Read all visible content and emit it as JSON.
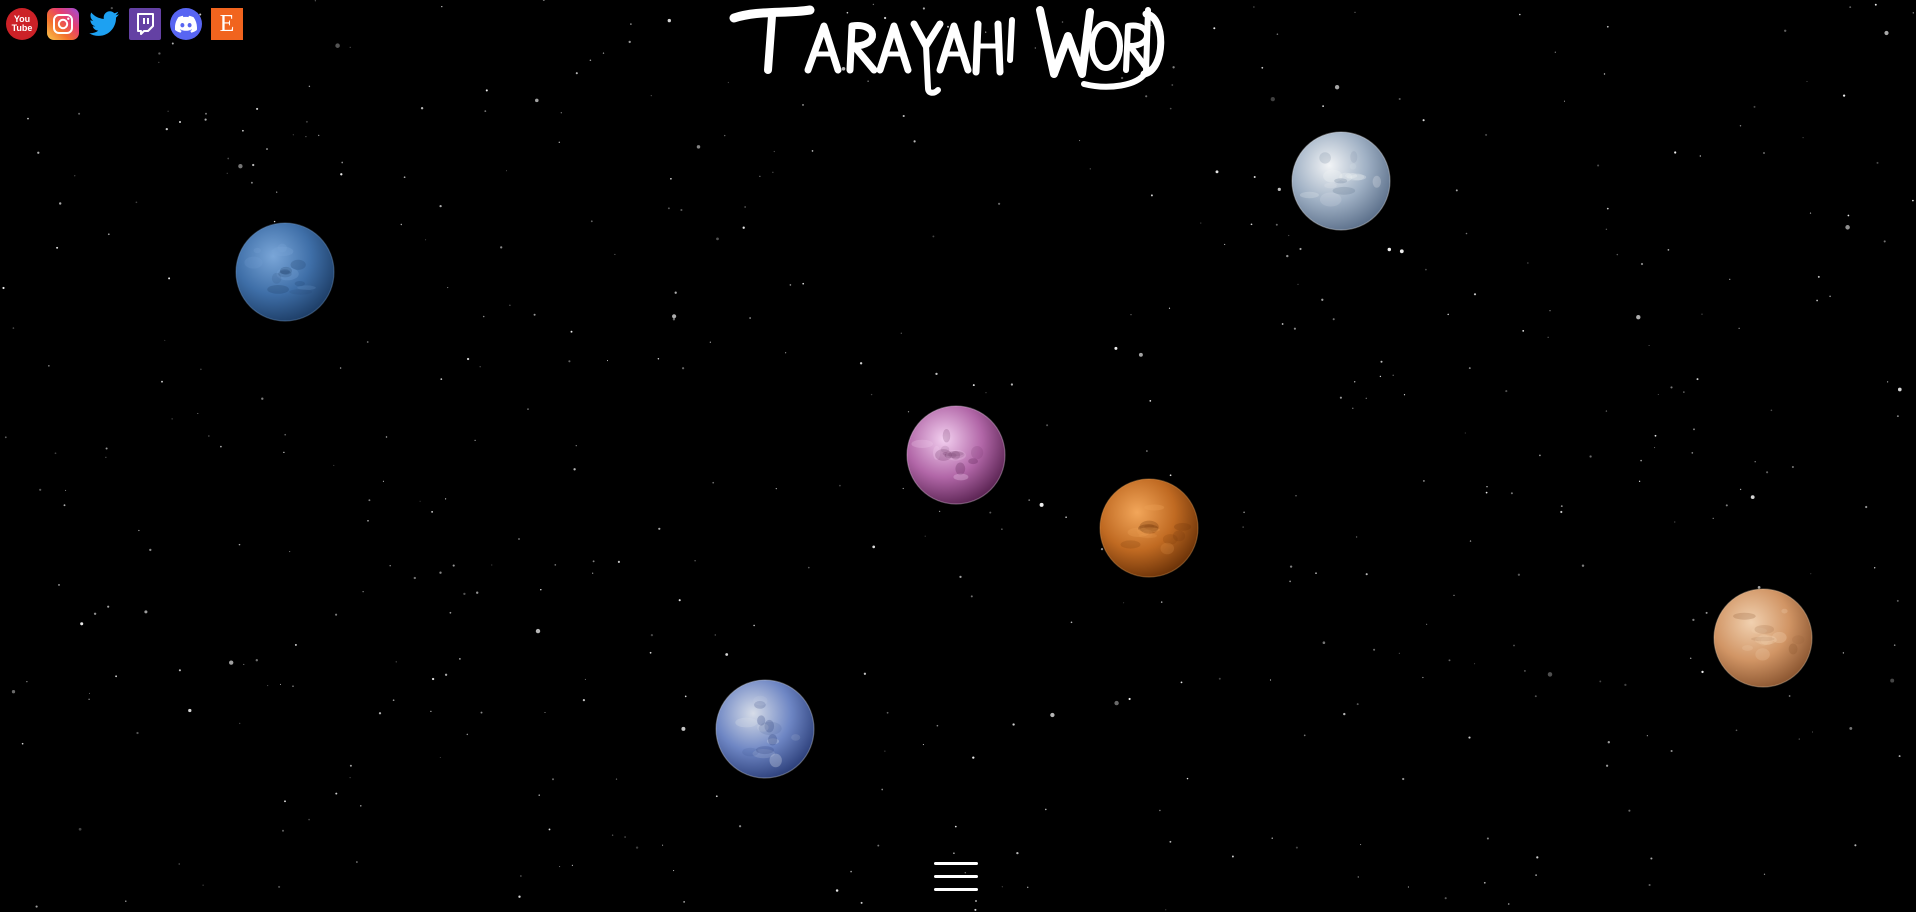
{
  "site": {
    "title": "TARAYAH WORLD"
  },
  "social": [
    {
      "name": "youtube",
      "label": "YouTube",
      "glyph_top": "You",
      "glyph_bottom": "Tube",
      "color": "#cc2127"
    },
    {
      "name": "instagram",
      "label": "Instagram",
      "color": "#e63d6f"
    },
    {
      "name": "twitter",
      "label": "Twitter",
      "color": "#1da1f2"
    },
    {
      "name": "twitch",
      "label": "Twitch",
      "color": "#6441a4"
    },
    {
      "name": "discord",
      "label": "Discord",
      "color": "#5865f2"
    },
    {
      "name": "etsy",
      "label": "Etsy",
      "glyph": "E",
      "color": "#f1641e"
    }
  ],
  "planets": [
    {
      "name": "neptune",
      "icon": "neptune-planet-icon",
      "colors": [
        "#7aa6d8",
        "#3f6fa8",
        "#1d3d66"
      ]
    },
    {
      "name": "earth",
      "icon": "earth-planet-icon",
      "colors": [
        "#f2f4f6",
        "#9fb0c4",
        "#5b6f8a"
      ]
    },
    {
      "name": "pink-planet",
      "icon": "pink-planet-icon",
      "colors": [
        "#f3d0f0",
        "#b267a8",
        "#5a2352"
      ]
    },
    {
      "name": "venus",
      "icon": "venus-planet-icon",
      "colors": [
        "#f2a65a",
        "#c06a22",
        "#6b3208"
      ]
    },
    {
      "name": "mars",
      "icon": "mars-planet-icon",
      "colors": [
        "#f1d1b0",
        "#d19565",
        "#8a5530"
      ]
    },
    {
      "name": "mercury",
      "icon": "mercury-planet-icon",
      "colors": [
        "#d7dde8",
        "#6e86c4",
        "#2c3f7a"
      ]
    }
  ],
  "menu": {
    "icon": "hamburger-menu-icon",
    "color": "#ffffff"
  }
}
